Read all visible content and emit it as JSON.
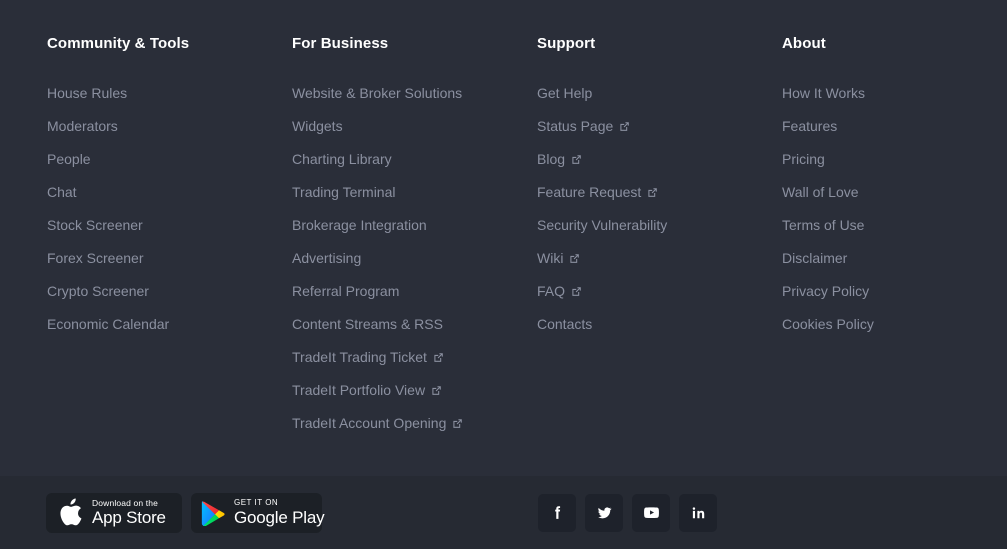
{
  "theme": {
    "background": "#2a2e39",
    "bottom_background": "#262a33",
    "heading_color": "#ffffff",
    "link_color": "#8b90a0",
    "badge_background": "#1c2026",
    "social_background": "#1e222b"
  },
  "columns": [
    {
      "heading": "Community & Tools",
      "links": [
        {
          "label": "House Rules",
          "external": false
        },
        {
          "label": "Moderators",
          "external": false
        },
        {
          "label": "People",
          "external": false
        },
        {
          "label": "Chat",
          "external": false
        },
        {
          "label": "Stock Screener",
          "external": false
        },
        {
          "label": "Forex Screener",
          "external": false
        },
        {
          "label": "Crypto Screener",
          "external": false
        },
        {
          "label": "Economic Calendar",
          "external": false
        }
      ]
    },
    {
      "heading": "For Business",
      "links": [
        {
          "label": "Website & Broker Solutions",
          "external": false
        },
        {
          "label": "Widgets",
          "external": false
        },
        {
          "label": "Charting Library",
          "external": false
        },
        {
          "label": "Trading Terminal",
          "external": false
        },
        {
          "label": "Brokerage Integration",
          "external": false
        },
        {
          "label": "Advertising",
          "external": false
        },
        {
          "label": "Referral Program",
          "external": false
        },
        {
          "label": "Content Streams & RSS",
          "external": false
        },
        {
          "label": "TradeIt Trading Ticket",
          "external": true
        },
        {
          "label": "TradeIt Portfolio View",
          "external": true
        },
        {
          "label": "TradeIt Account Opening",
          "external": true
        }
      ]
    },
    {
      "heading": "Support",
      "links": [
        {
          "label": "Get Help",
          "external": false
        },
        {
          "label": "Status Page",
          "external": true
        },
        {
          "label": "Blog",
          "external": true
        },
        {
          "label": "Feature Request",
          "external": true
        },
        {
          "label": "Security Vulnerability",
          "external": false
        },
        {
          "label": "Wiki",
          "external": true
        },
        {
          "label": "FAQ",
          "external": true
        },
        {
          "label": "Contacts",
          "external": false
        }
      ]
    },
    {
      "heading": "About",
      "links": [
        {
          "label": "How It Works",
          "external": false
        },
        {
          "label": "Features",
          "external": false
        },
        {
          "label": "Pricing",
          "external": false
        },
        {
          "label": "Wall of Love",
          "external": false
        },
        {
          "label": "Terms of Use",
          "external": false
        },
        {
          "label": "Disclaimer",
          "external": false
        },
        {
          "label": "Privacy Policy",
          "external": false
        },
        {
          "label": "Cookies Policy",
          "external": false
        }
      ]
    }
  ],
  "bottom_bar": {
    "badges": [
      {
        "icon": "apple-icon",
        "top_text": "Download on the",
        "bottom_text": "App Store"
      },
      {
        "icon": "google-play-icon",
        "top_text": "GET IT ON",
        "bottom_text": "Google Play"
      }
    ],
    "socials": [
      {
        "icon": "facebook-icon",
        "name": "Facebook"
      },
      {
        "icon": "twitter-icon",
        "name": "Twitter"
      },
      {
        "icon": "youtube-icon",
        "name": "YouTube"
      },
      {
        "icon": "linkedin-icon",
        "name": "LinkedIn"
      }
    ]
  },
  "icons": {
    "external_link": "external-link-icon"
  }
}
